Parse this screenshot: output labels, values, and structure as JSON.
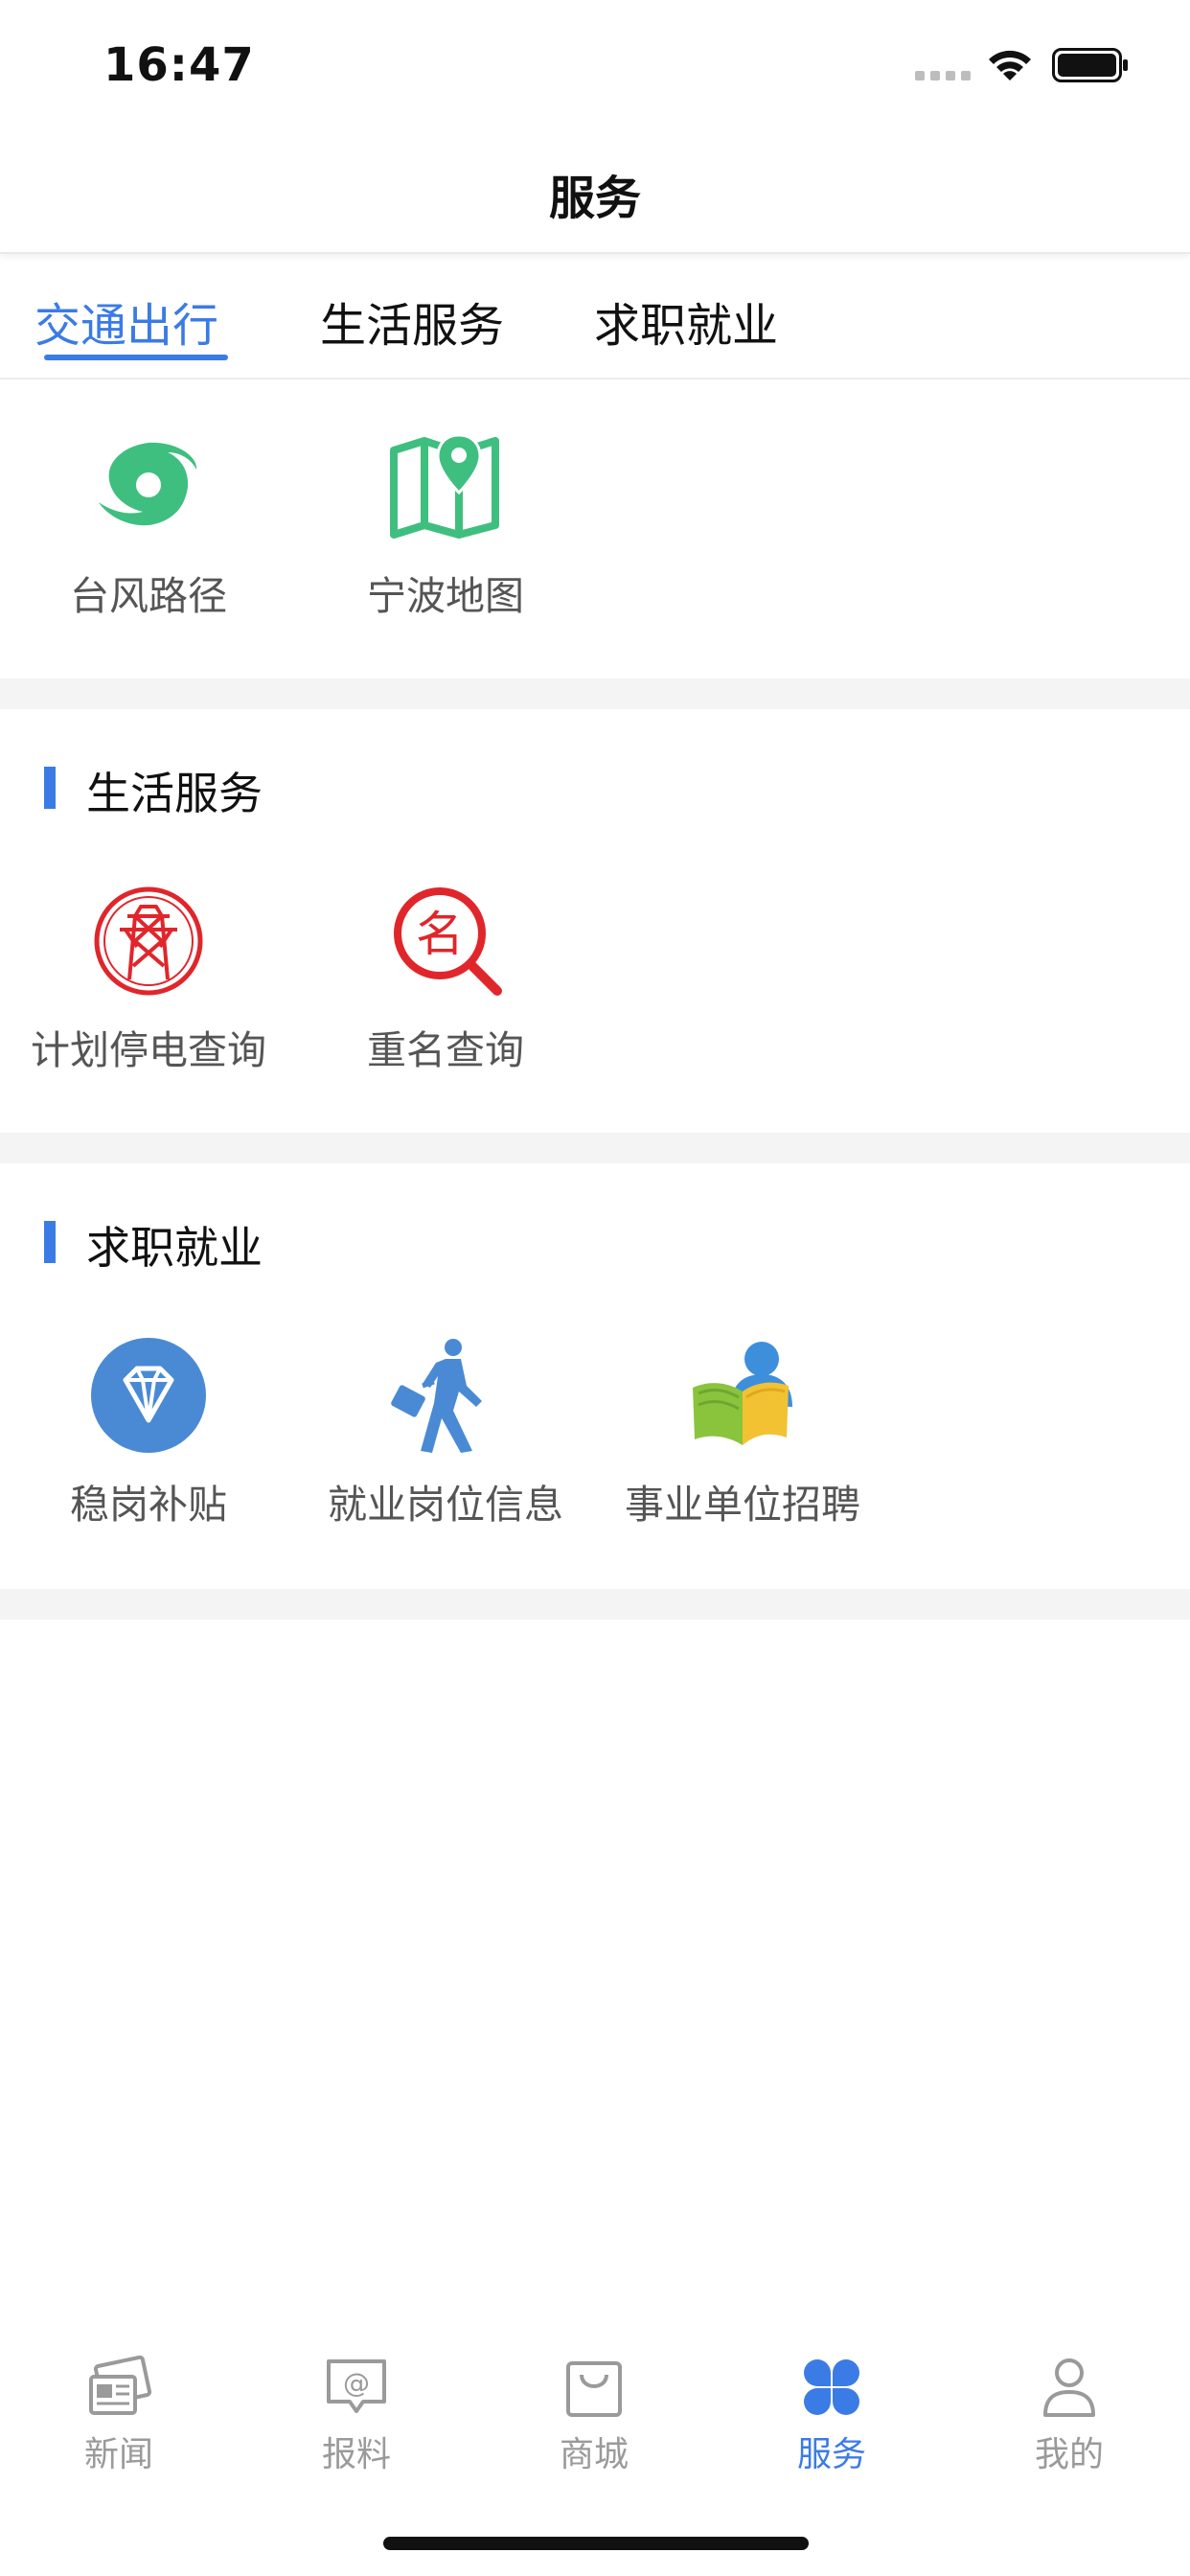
{
  "status_bar": {
    "time": "16:47"
  },
  "nav": {
    "title": "服务"
  },
  "tabs": [
    {
      "label": "交通出行",
      "active": true
    },
    {
      "label": "生活服务",
      "active": false
    },
    {
      "label": "求职就业",
      "active": false
    }
  ],
  "sections": {
    "traffic": {
      "items": [
        {
          "label": "台风路径",
          "icon": "typhoon-icon"
        },
        {
          "label": "宁波地图",
          "icon": "map-pin-icon"
        }
      ]
    },
    "life": {
      "title": "生活服务",
      "items": [
        {
          "label": "计划停电查询",
          "icon": "power-tower-icon"
        },
        {
          "label": "重名查询",
          "icon": "name-search-icon"
        }
      ]
    },
    "jobs": {
      "title": "求职就业",
      "items": [
        {
          "label": "稳岗补贴",
          "icon": "diamond-icon"
        },
        {
          "label": "就业岗位信息",
          "icon": "walking-briefcase-icon"
        },
        {
          "label": "事业单位招聘",
          "icon": "person-book-icon"
        }
      ]
    }
  },
  "tabbar": [
    {
      "label": "新闻",
      "icon": "news-icon",
      "active": false
    },
    {
      "label": "报料",
      "icon": "report-icon",
      "active": false
    },
    {
      "label": "商城",
      "icon": "shopping-bag-icon",
      "active": false
    },
    {
      "label": "服务",
      "icon": "clover-icon",
      "active": true
    },
    {
      "label": "我的",
      "icon": "user-icon",
      "active": false
    }
  ],
  "colors": {
    "accent": "#3b7be6",
    "green": "#3fbf7f",
    "red": "#e0262b",
    "inactive": "#9a9a9a"
  }
}
